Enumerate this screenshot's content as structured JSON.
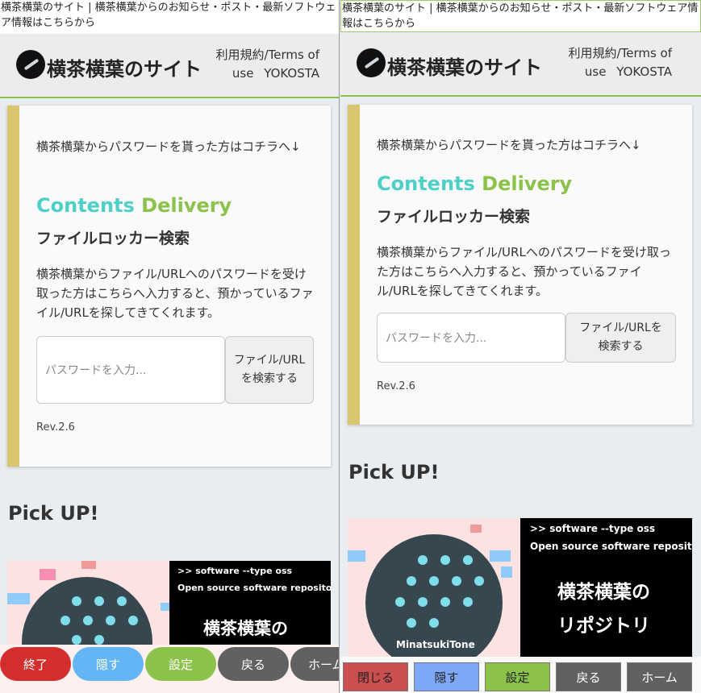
{
  "titlebar": "横茶横葉のサイト | 横茶横葉からのお知らせ・ポスト・最新ソフトウェア情報はこちらから",
  "site": {
    "name": "横茶横葉のサイト",
    "nav_terms": "利用規約/Terms of use",
    "nav_author": "YOKOSTA"
  },
  "card": {
    "intro": "横茶横葉からパスワードを貰った方はコチラへ↓",
    "cd_part1": "Contents",
    "cd_part2": "Delivery",
    "locker_title": "ファイルロッカー検索",
    "description": "横茶横葉からファイル/URLへのパスワードを受け取った方はこちらへ入力すると、預かっているファイル/URLを探してきてくれます。",
    "password_placeholder": "パスワードを入力...",
    "search_button": "ファイル/URLを検索する",
    "revision": "Rev.2.6"
  },
  "pickup": {
    "heading": "Pick UP!",
    "banner_line1": ">> software --type oss",
    "banner_line2": "Open source software repositories",
    "banner_title_1": "横茶横葉の",
    "banner_title_2": "リポジトリ",
    "banner_author": "MinatsukiTone"
  },
  "left_toolbar": {
    "exit": "終了",
    "hide": "隠す",
    "settings": "設定",
    "back": "戻る",
    "home": "ホーム"
  },
  "right_toolbar": {
    "close": "閉じる",
    "hide": "隠す",
    "settings": "設定",
    "back": "戻る",
    "home": "ホーム"
  },
  "colors": {
    "accent_green": "#8bc34a",
    "accent_teal": "#4dd0c8",
    "card_border": "#d8c56e",
    "exit_red": "#d32f2f",
    "hide_blue": "#64b5f6",
    "settings_green": "#8bc34a",
    "back_gray": "#616161"
  }
}
